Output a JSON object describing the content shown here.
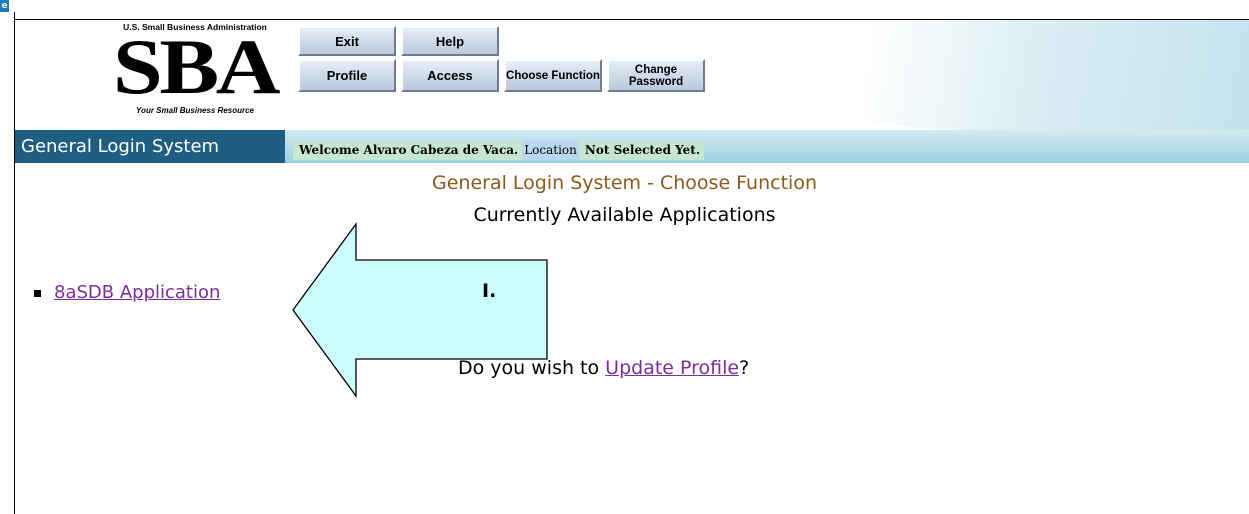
{
  "logo": {
    "agency": "U.S. Small Business Administration",
    "wordmark": "SBA",
    "tagline": "Your Small Business Resource"
  },
  "nav": {
    "exit": "Exit",
    "help": "Help",
    "profile": "Profile",
    "access": "Access",
    "choose_function": "Choose Function",
    "change_password": "Change Password"
  },
  "title_bar": {
    "app_name": "General Login System",
    "welcome_prefix": "Welcome Alvaro Cabeza de Vaca.",
    "location_label": "Location",
    "location_value": "Not Selected Yet."
  },
  "main": {
    "heading": "General Login System - Choose Function",
    "subheading": "Currently Available Applications",
    "applications": [
      "8aSDB Application"
    ],
    "update_prefix": "Do you wish to ",
    "update_link": "Update Profile",
    "update_suffix": "?"
  },
  "annotation": {
    "step_label": "I."
  },
  "colors": {
    "title_left_bg": "#1f5e82",
    "heading": "#8a5a1a",
    "link": "#7b2d9a",
    "arrow_fill": "#ccfcfc"
  }
}
